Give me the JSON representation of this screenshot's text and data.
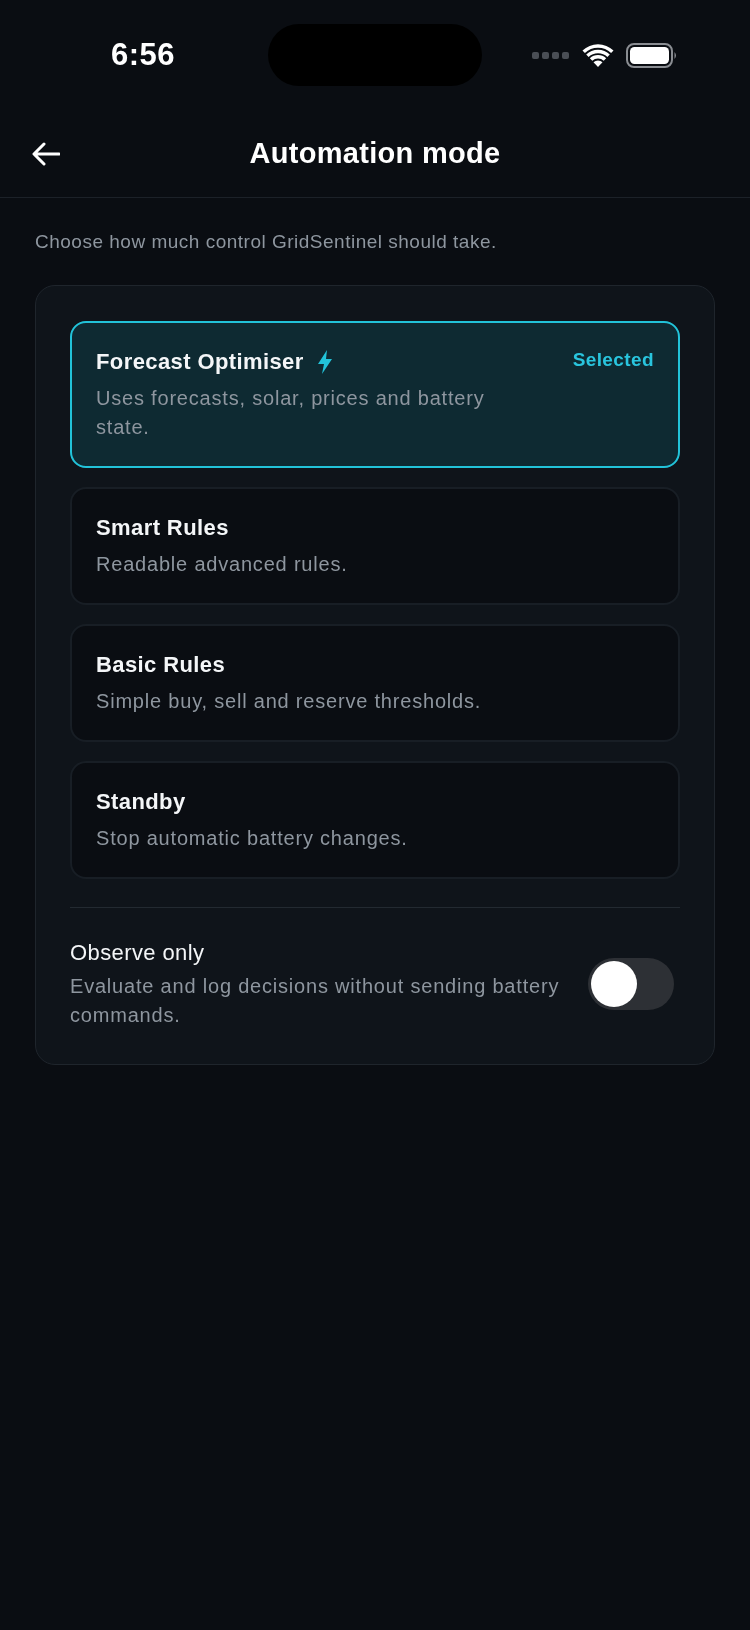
{
  "status_bar": {
    "time": "6:56"
  },
  "header": {
    "title": "Automation mode"
  },
  "intro": "Choose how much control GridSentinel should take.",
  "modes": [
    {
      "kind": "featured",
      "title": "Forecast Optimiser",
      "description": "Uses forecasts, solar, prices and battery state.",
      "selected": true,
      "badge": "Selected"
    },
    {
      "kind": "standard",
      "title": "Smart Rules",
      "description": "Readable advanced rules.",
      "selected": false
    },
    {
      "kind": "standard",
      "title": "Basic Rules",
      "description": "Simple buy, sell and reserve thresholds.",
      "selected": false
    },
    {
      "kind": "standard",
      "title": "Standby",
      "description": "Stop automatic battery changes.",
      "selected": false
    }
  ],
  "observe_only": {
    "title": "Observe only",
    "description": "Evaluate and log decisions without sending battery commands.",
    "on": false
  }
}
